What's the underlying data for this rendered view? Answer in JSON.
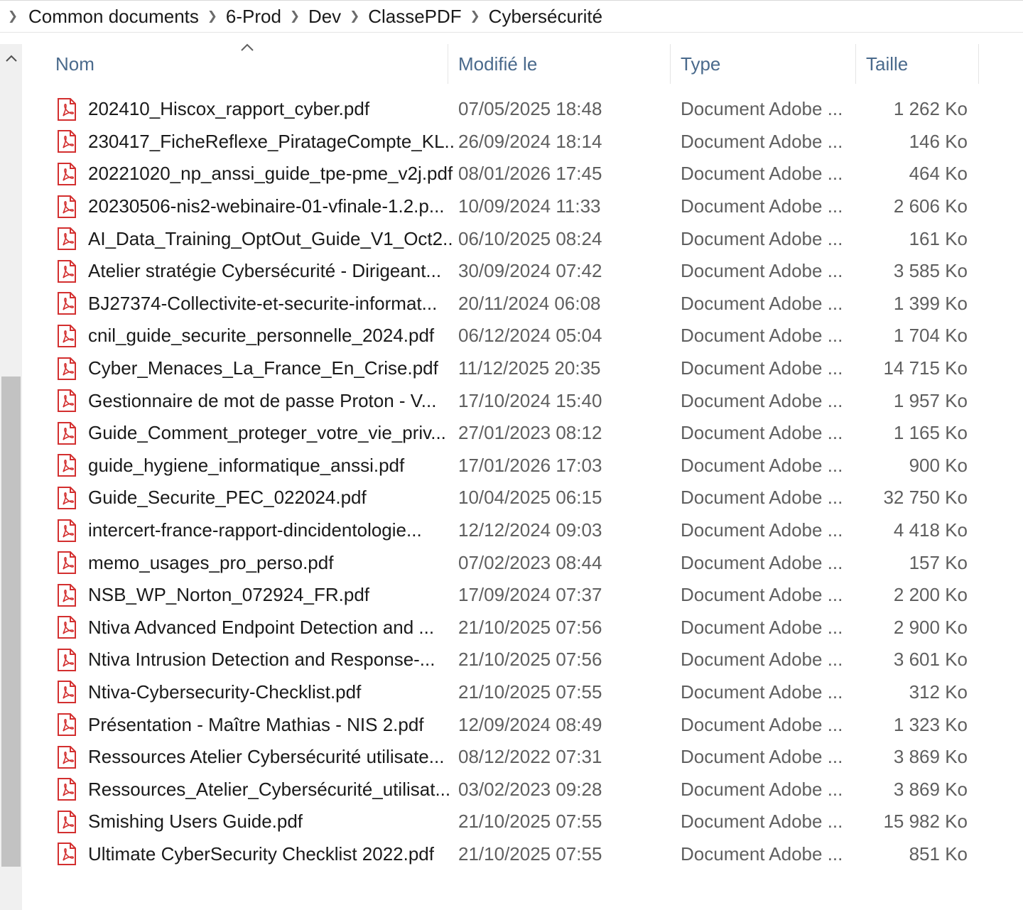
{
  "breadcrumb": {
    "items": [
      "Common documents",
      "6-Prod",
      "Dev",
      "ClassePDF",
      "Cybersécurité"
    ]
  },
  "columns": {
    "name": "Nom",
    "modified": "Modifié le",
    "type": "Type",
    "size": "Taille"
  },
  "colors": {
    "pdf_icon": "#d32f2f",
    "header_text": "#4a6a8c",
    "secondary_text": "#5f5f5f"
  },
  "files": [
    {
      "name": "202410_Hiscox_rapport_cyber.pdf",
      "modified": "07/05/2025 18:48",
      "type": "Document Adobe ...",
      "size": "1 262 Ko"
    },
    {
      "name": "230417_FicheReflexe_PiratageCompte_KL...",
      "modified": "26/09/2024 18:14",
      "type": "Document Adobe ...",
      "size": "146 Ko"
    },
    {
      "name": "20221020_np_anssi_guide_tpe-pme_v2j.pdf",
      "modified": "08/01/2026 17:45",
      "type": "Document Adobe ...",
      "size": "464 Ko"
    },
    {
      "name": "20230506-nis2-webinaire-01-vfinale-1.2.p...",
      "modified": "10/09/2024 11:33",
      "type": "Document Adobe ...",
      "size": "2 606 Ko"
    },
    {
      "name": "AI_Data_Training_OptOut_Guide_V1_Oct2...",
      "modified": "06/10/2025 08:24",
      "type": "Document Adobe ...",
      "size": "161 Ko"
    },
    {
      "name": "Atelier stratégie Cybersécurité - Dirigeant...",
      "modified": "30/09/2024 07:42",
      "type": "Document Adobe ...",
      "size": "3 585 Ko"
    },
    {
      "name": "BJ27374-Collectivite-et-securite-informat...",
      "modified": "20/11/2024 06:08",
      "type": "Document Adobe ...",
      "size": "1 399 Ko"
    },
    {
      "name": "cnil_guide_securite_personnelle_2024.pdf",
      "modified": "06/12/2024 05:04",
      "type": "Document Adobe ...",
      "size": "1 704 Ko"
    },
    {
      "name": "Cyber_Menaces_La_France_En_Crise.pdf",
      "modified": "11/12/2025 20:35",
      "type": "Document Adobe ...",
      "size": "14 715 Ko"
    },
    {
      "name": "Gestionnaire de mot de passe Proton - V...",
      "modified": "17/10/2024 15:40",
      "type": "Document Adobe ...",
      "size": "1 957 Ko"
    },
    {
      "name": "Guide_Comment_proteger_votre_vie_priv...",
      "modified": "27/01/2023 08:12",
      "type": "Document Adobe ...",
      "size": "1 165 Ko"
    },
    {
      "name": "guide_hygiene_informatique_anssi.pdf",
      "modified": "17/01/2026 17:03",
      "type": "Document Adobe ...",
      "size": "900 Ko"
    },
    {
      "name": "Guide_Securite_PEC_022024.pdf",
      "modified": "10/04/2025 06:15",
      "type": "Document Adobe ...",
      "size": "32 750 Ko"
    },
    {
      "name": "intercert-france-rapport-dincidentologie...",
      "modified": "12/12/2024 09:03",
      "type": "Document Adobe ...",
      "size": "4 418 Ko"
    },
    {
      "name": "memo_usages_pro_perso.pdf",
      "modified": "07/02/2023 08:44",
      "type": "Document Adobe ...",
      "size": "157 Ko"
    },
    {
      "name": "NSB_WP_Norton_072924_FR.pdf",
      "modified": "17/09/2024 07:37",
      "type": "Document Adobe ...",
      "size": "2 200 Ko"
    },
    {
      "name": "Ntiva Advanced Endpoint Detection and ...",
      "modified": "21/10/2025 07:56",
      "type": "Document Adobe ...",
      "size": "2 900 Ko"
    },
    {
      "name": "Ntiva Intrusion Detection and Response-...",
      "modified": "21/10/2025 07:56",
      "type": "Document Adobe ...",
      "size": "3 601 Ko"
    },
    {
      "name": "Ntiva-Cybersecurity-Checklist.pdf",
      "modified": "21/10/2025 07:55",
      "type": "Document Adobe ...",
      "size": "312 Ko"
    },
    {
      "name": "Présentation - Maître Mathias - NIS 2.pdf",
      "modified": "12/09/2024 08:49",
      "type": "Document Adobe ...",
      "size": "1 323 Ko"
    },
    {
      "name": "Ressources Atelier Cybersécurité utilisate...",
      "modified": "08/12/2022 07:31",
      "type": "Document Adobe ...",
      "size": "3 869 Ko"
    },
    {
      "name": "Ressources_Atelier_Cybersécurité_utilisat...",
      "modified": "03/02/2023 09:28",
      "type": "Document Adobe ...",
      "size": "3 869 Ko"
    },
    {
      "name": "Smishing Users Guide.pdf",
      "modified": "21/10/2025 07:55",
      "type": "Document Adobe ...",
      "size": "15 982 Ko"
    },
    {
      "name": "Ultimate CyberSecurity Checklist 2022.pdf",
      "modified": "21/10/2025 07:55",
      "type": "Document Adobe ...",
      "size": "851 Ko"
    }
  ]
}
